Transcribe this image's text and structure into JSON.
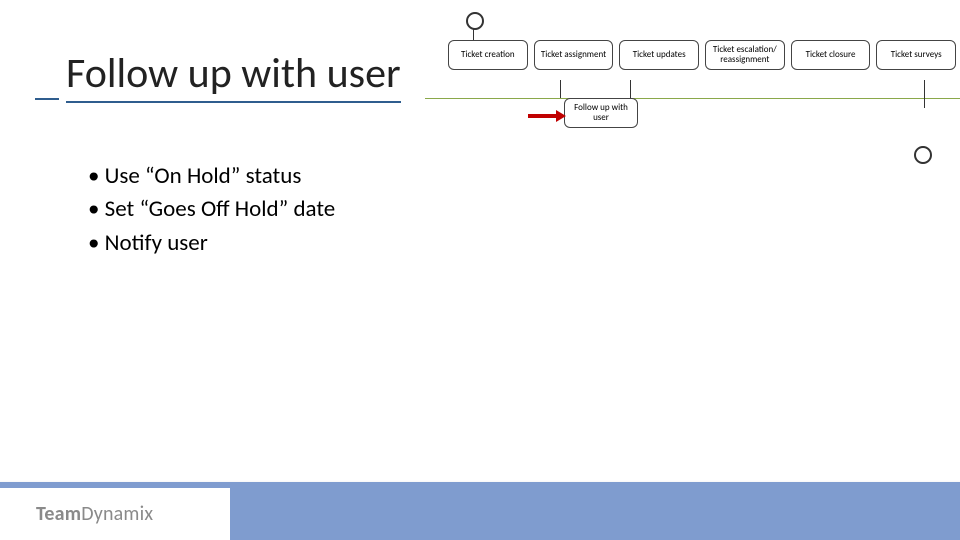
{
  "title": "Follow up with user",
  "bullets": [
    "Use “On Hold” status",
    "Set “Goes Off Hold” date",
    "Notify user"
  ],
  "flow": {
    "boxes": [
      "Ticket creation",
      "Ticket assignment",
      "Ticket updates",
      "Ticket escalation/ reassignment",
      "Ticket closure",
      "Ticket surveys"
    ],
    "subbox": "Follow up with user"
  },
  "logo": {
    "part1": "Team",
    "part2": "Dynamix"
  }
}
